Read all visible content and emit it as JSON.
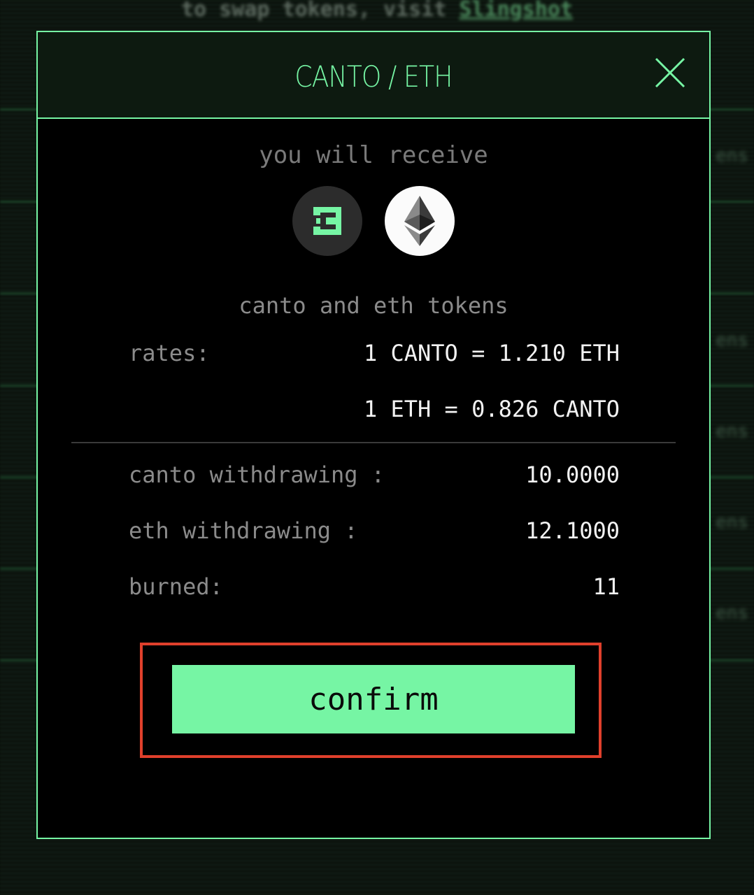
{
  "background": {
    "notice_prefix": "to swap tokens, visit ",
    "notice_link": "Slingshot",
    "side_fragments": [
      "ens",
      "ens",
      "ens",
      "ens",
      "ens"
    ]
  },
  "modal": {
    "title": "CANTO / ETH",
    "close_icon": "close-icon",
    "subtitle": "you will receive",
    "tokens": [
      {
        "name": "canto",
        "icon": "canto-logo-icon"
      },
      {
        "name": "eth",
        "icon": "ethereum-logo-icon"
      }
    ],
    "tokens_label": "canto and eth tokens",
    "rates_label": "rates:",
    "rate_1": "1 CANTO = 1.210 ETH",
    "rate_2": "1 ETH = 0.826 CANTO",
    "canto_withdrawing_label": "canto withdrawing :",
    "canto_withdrawing_value": "10.0000",
    "eth_withdrawing_label": "eth withdrawing :",
    "eth_withdrawing_value": "12.1000",
    "burned_label": "burned:",
    "burned_value": "11",
    "confirm_label": "confirm"
  },
  "colors": {
    "accent": "#76f5a4",
    "highlight": "#e0402c",
    "background": "#000000"
  }
}
